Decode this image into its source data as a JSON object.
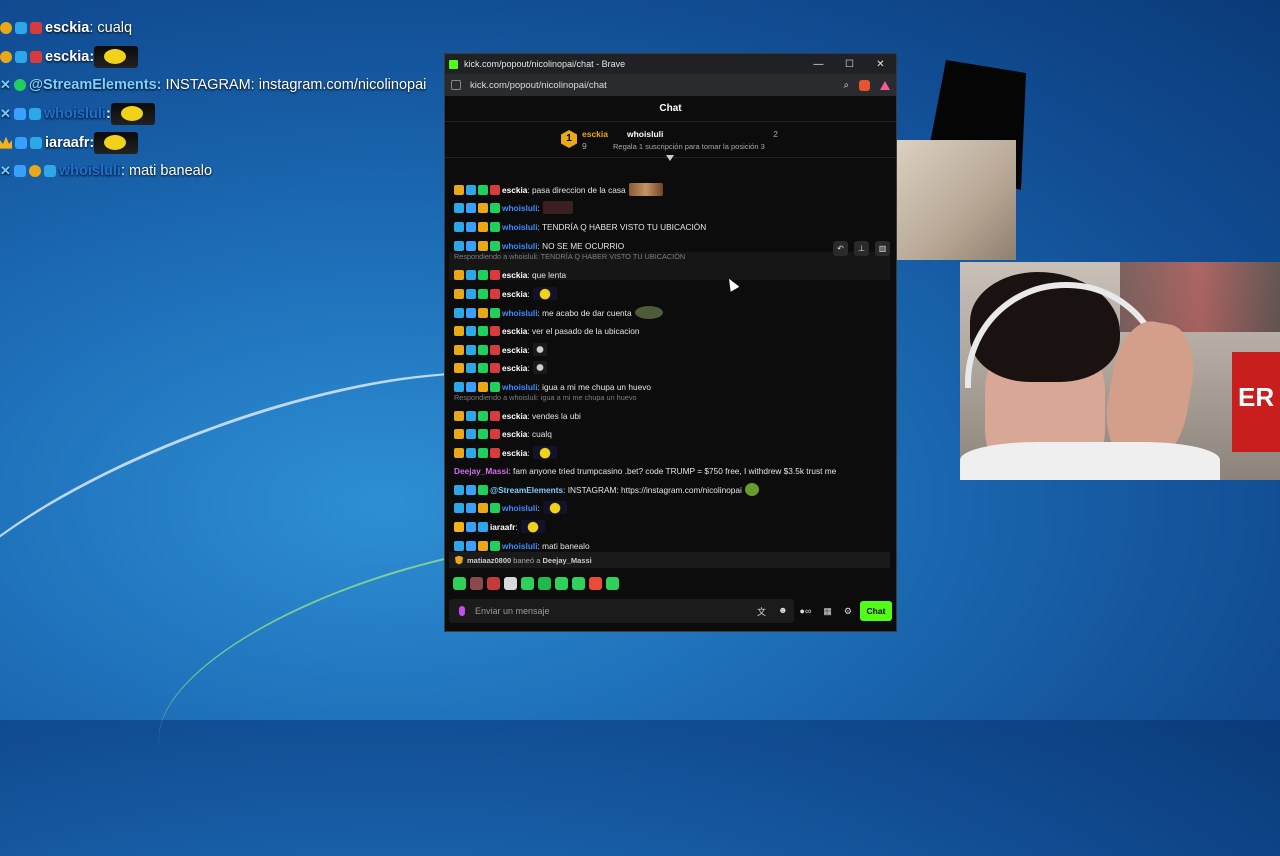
{
  "overlay": [
    {
      "user": "esckia",
      "user_color": "#e8e8e8",
      "text": ": cualq",
      "badges": [
        "gold",
        "blue",
        "red"
      ],
      "emote": false
    },
    {
      "user": "esckia",
      "user_color": "#e8e8e8",
      "text": ":",
      "badges": [
        "gold",
        "blue",
        "red"
      ],
      "emote": true
    },
    {
      "user": "@StreamElements:",
      "user_color": "#7fd0ff",
      "text": "INSTAGRAM: instagram.com/nicolinopai",
      "badges": [
        "sword",
        "green"
      ],
      "emote": false
    },
    {
      "user": "whoisluli",
      "user_color": "#1c6fd6",
      "text": ":",
      "badges": [
        "sword",
        "gv",
        "blue"
      ],
      "emote": true
    },
    {
      "user": "iaraafr",
      "user_color": "#e8e8e8",
      "text": ":",
      "badges": [
        "crown",
        "gv",
        "blue"
      ],
      "emote": true
    },
    {
      "user": "whoisluli",
      "user_color": "#1c6fd6",
      "text": ": mati banealo",
      "badges": [
        "sword",
        "gv",
        "gold",
        "blue"
      ],
      "emote": false
    }
  ],
  "window": {
    "title": "kick.com/popout/nicolinopai/chat - Brave",
    "url": "kick.com/popout/nicolinopai/chat",
    "controls": [
      "—",
      "☐",
      "✕"
    ]
  },
  "chat": {
    "header": "Chat",
    "leaderboard": {
      "rank": "1",
      "name1": "esckia",
      "count1": "9",
      "name2": "whoisluli",
      "count2": "2",
      "sub": "Regala 1 suscripción para tomar la posición 3"
    },
    "messages": [
      {
        "user": "esckia",
        "color": "#ffffff",
        "text": ": pasa direccion de la casa",
        "emote": "brown"
      },
      {
        "user": "whoisluli",
        "color": "#3a8cff",
        "text": ":",
        "emote": "dark"
      },
      {
        "user": "whoisluli",
        "color": "#3a8cff",
        "text": ": TENDRÍA Q HABER VISTO TU UBICACIÓN",
        "emote": ""
      },
      {
        "user": "whoisluli",
        "color": "#3a8cff",
        "text": ": NO SE ME OCURRIO",
        "emote": ""
      },
      {
        "user": "esckia",
        "color": "#ffffff",
        "text": ": que lenta",
        "emote": ""
      },
      {
        "user": "esckia",
        "color": "#ffffff",
        "text": ":",
        "emote": "yellow"
      },
      {
        "user": "whoisluli",
        "color": "#3a8cff",
        "text": ": me acabo de dar cuenta",
        "emote": "frog"
      },
      {
        "user": "esckia",
        "color": "#ffffff",
        "text": ": ver el pasado de la ubicacion",
        "emote": ""
      },
      {
        "user": "esckia",
        "color": "#ffffff",
        "text": ":",
        "emote": "gray"
      },
      {
        "user": "esckia",
        "color": "#ffffff",
        "text": ":",
        "emote": "gray"
      },
      {
        "user": "whoisluli",
        "color": "#3a8cff",
        "text": ": igua a mi me chupa un huevo",
        "emote": ""
      },
      {
        "user": "esckia",
        "color": "#ffffff",
        "text": ": vendes la ubi",
        "emote": ""
      },
      {
        "user": "esckia",
        "color": "#ffffff",
        "text": ": cualq",
        "emote": ""
      },
      {
        "user": "esckia",
        "color": "#ffffff",
        "text": ":",
        "emote": "yellow"
      },
      {
        "user": "Deejay_Massi",
        "color": "#d56cf0",
        "text": ": fam anyone tried trumpcasino .bet? code TRUMP = $750 free, I withdrew $3.5k trust me",
        "emote": ""
      },
      {
        "user": "@StreamElements",
        "color": "#7fd0ff",
        "text": ": INSTAGRAM: https://instagram.com/nicolinopai",
        "emote": "green"
      },
      {
        "user": "whoisluli",
        "color": "#3a8cff",
        "text": ":",
        "emote": "yellow"
      },
      {
        "user": "iaraafr",
        "color": "#ffffff",
        "text": ":",
        "emote": "yellow"
      },
      {
        "user": "whoisluli",
        "color": "#3a8cff",
        "text": ": mati banealo",
        "emote": ""
      }
    ],
    "replies": [
      "Respondiendo a whoisluli: TENDRÍA Q HABER VISTO TU UBICACIÓN",
      "Respondiendo a whoisluli: igua a mi me chupa un huevo"
    ],
    "ban": {
      "mod": "matiaaz0800",
      "action": "baneó a",
      "target": "Deejay_Massi"
    },
    "input_placeholder": "Enviar un mensaje",
    "send_label": "Chat"
  },
  "colors": {
    "kick_green": "#53fc18",
    "bg": "#0c0c0c"
  }
}
